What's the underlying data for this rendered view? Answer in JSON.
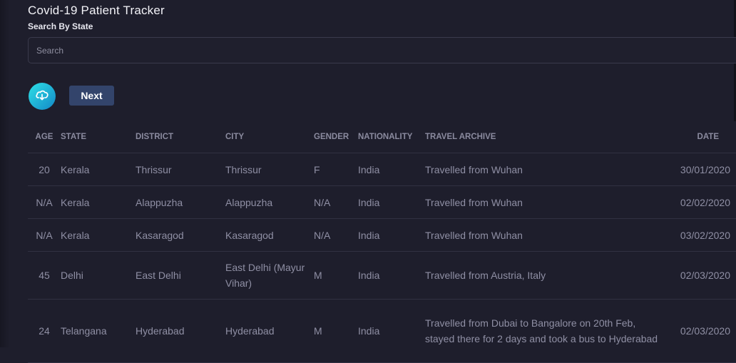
{
  "app": {
    "title": "Covid-19 Patient Tracker"
  },
  "search": {
    "label": "Search By State",
    "placeholder": "Search"
  },
  "actions": {
    "next_label": "Next",
    "download_icon": "cloud-download-icon"
  },
  "colors": {
    "background": "#1e1e2c",
    "accent_gradient_start": "#2ee0e6",
    "accent_gradient_end": "#1388c7",
    "next_button": "#33446b"
  },
  "table": {
    "headers": {
      "age": "AGE",
      "state": "STATE",
      "district": "DISTRICT",
      "city": "CITY",
      "gender": "GENDER",
      "nationality": "NATIONALITY",
      "travel": "TRAVEL ARCHIVE",
      "date": "DATE"
    },
    "rows": [
      {
        "age": "20",
        "state": "Kerala",
        "district": "Thrissur",
        "city": "Thrissur",
        "gender": "F",
        "nationality": "India",
        "travel": "Travelled from Wuhan",
        "date": "30/01/2020"
      },
      {
        "age": "N/A",
        "state": "Kerala",
        "district": "Alappuzha",
        "city": "Alappuzha",
        "gender": "N/A",
        "nationality": "India",
        "travel": "Travelled from Wuhan",
        "date": "02/02/2020"
      },
      {
        "age": "N/A",
        "state": "Kerala",
        "district": "Kasaragod",
        "city": "Kasaragod",
        "gender": "N/A",
        "nationality": "India",
        "travel": "Travelled from Wuhan",
        "date": "03/02/2020"
      },
      {
        "age": "45",
        "state": "Delhi",
        "district": "East Delhi",
        "city": "East Delhi (Mayur Vihar)",
        "gender": "M",
        "nationality": "India",
        "travel": "Travelled from Austria, Italy",
        "date": "02/03/2020"
      },
      {
        "age": "24",
        "state": "Telangana",
        "district": "Hyderabad",
        "city": "Hyderabad",
        "gender": "M",
        "nationality": "India",
        "travel": "Travelled from Dubai to Bangalore on 20th Feb, stayed there for 2 days and took a bus to Hyderabad",
        "date": "02/03/2020"
      }
    ]
  }
}
